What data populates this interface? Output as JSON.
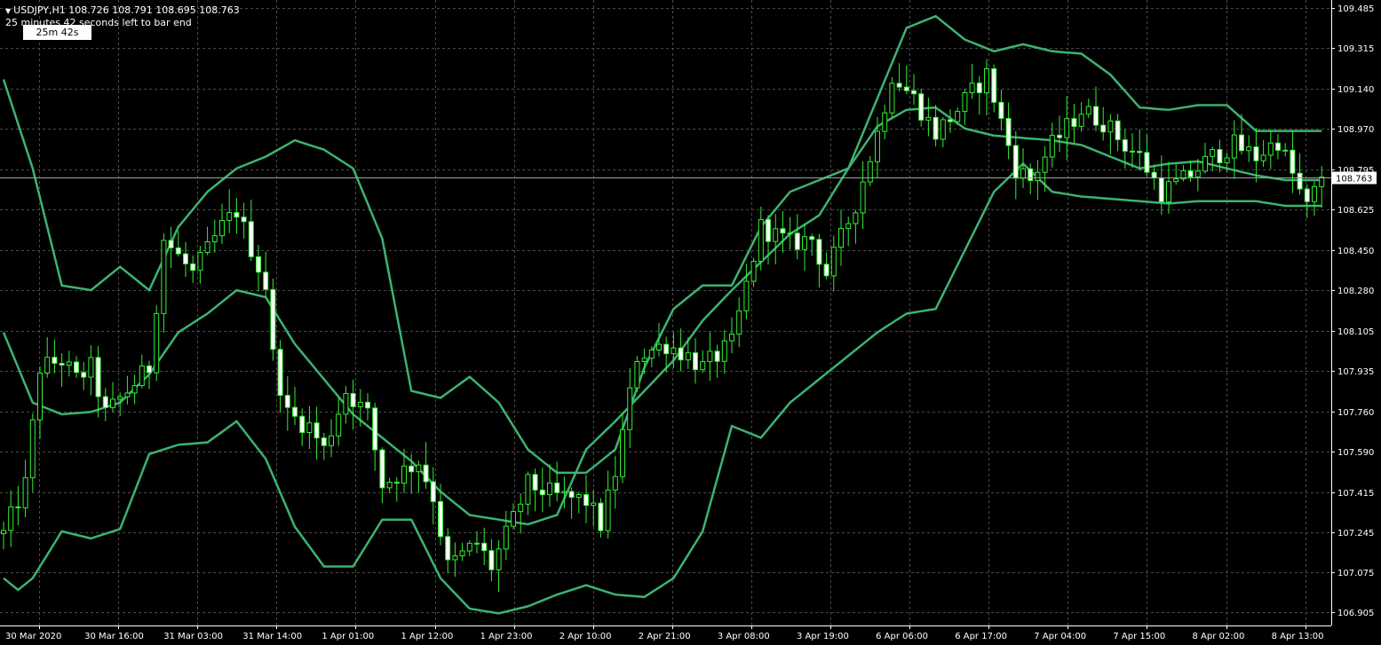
{
  "header": {
    "symbol_line": "USDJPY,H1  108.726 108.791 108.695 108.763",
    "countdown_line": "25 minutes 42 seconds left to bar end",
    "timer_label": "25m 42s"
  },
  "colors": {
    "background": "#000000",
    "grid": "#4a4a4a",
    "axis": "#ffffff",
    "candle": "#32f032",
    "bands": "#3cb371",
    "price_line": "#a0a0a0",
    "price_tag_bg": "#ffffff",
    "price_tag_text": "#000000"
  },
  "chart_data": {
    "type": "candlestick",
    "symbol": "USDJPY",
    "timeframe": "H1",
    "current_price": 108.763,
    "current_price_label": "108.763",
    "ylim": [
      106.85,
      109.53
    ],
    "y_ticks": [
      106.905,
      107.075,
      107.245,
      107.415,
      107.59,
      107.76,
      107.935,
      108.105,
      108.28,
      108.45,
      108.625,
      108.795,
      108.97,
      109.14,
      109.315,
      109.485
    ],
    "y_tick_labels": [
      "106.905",
      "107.075",
      "107.245",
      "107.415",
      "107.590",
      "107.760",
      "107.935",
      "108.105",
      "108.280",
      "108.450",
      "108.625",
      "108.795",
      "108.970",
      "109.140",
      "109.315",
      "109.485"
    ],
    "x_labels": [
      "30 Mar 2020",
      "30 Mar 16:00",
      "31 Mar 03:00",
      "31 Mar 14:00",
      "1 Apr 01:00",
      "1 Apr 12:00",
      "1 Apr 23:00",
      "2 Apr 10:00",
      "2 Apr 21:00",
      "3 Apr 08:00",
      "3 Apr 19:00",
      "6 Apr 06:00",
      "6 Apr 17:00",
      "7 Apr 04:00",
      "7 Apr 15:00",
      "8 Apr 02:00",
      "8 Apr 13:00"
    ],
    "bar_count": 182,
    "bars_per_label": 11,
    "anchors": [
      [
        0,
        107.24
      ],
      [
        3,
        107.45
      ],
      [
        5,
        107.95
      ],
      [
        8,
        107.98
      ],
      [
        10,
        107.9
      ],
      [
        12,
        107.95
      ],
      [
        14,
        107.75
      ],
      [
        17,
        107.85
      ],
      [
        20,
        107.95
      ],
      [
        22,
        108.5
      ],
      [
        26,
        108.35
      ],
      [
        30,
        108.55
      ],
      [
        32,
        108.62
      ],
      [
        36,
        108.3
      ],
      [
        37,
        108.0
      ],
      [
        39,
        107.75
      ],
      [
        42,
        107.7
      ],
      [
        44,
        107.6
      ],
      [
        47,
        107.85
      ],
      [
        50,
        107.75
      ],
      [
        52,
        107.45
      ],
      [
        57,
        107.55
      ],
      [
        59,
        107.4
      ],
      [
        61,
        107.1
      ],
      [
        65,
        107.2
      ],
      [
        67,
        107.1
      ],
      [
        70,
        107.3
      ],
      [
        72,
        107.45
      ],
      [
        76,
        107.4
      ],
      [
        80,
        107.38
      ],
      [
        82,
        107.28
      ],
      [
        84,
        107.5
      ],
      [
        87,
        108.0
      ],
      [
        91,
        108.05
      ],
      [
        94,
        108.0
      ],
      [
        96,
        107.95
      ],
      [
        100,
        108.05
      ],
      [
        104,
        108.55
      ],
      [
        108,
        108.48
      ],
      [
        111,
        108.5
      ],
      [
        113,
        108.35
      ],
      [
        117,
        108.65
      ],
      [
        120,
        108.95
      ],
      [
        122,
        109.2
      ],
      [
        125,
        109.1
      ],
      [
        128,
        108.95
      ],
      [
        131,
        109.05
      ],
      [
        135,
        109.2
      ],
      [
        139,
        108.8
      ],
      [
        141,
        108.75
      ],
      [
        144,
        108.9
      ],
      [
        148,
        109.05
      ],
      [
        151,
        109.0
      ],
      [
        154,
        108.9
      ],
      [
        156,
        108.85
      ],
      [
        159,
        108.7
      ],
      [
        162,
        108.75
      ],
      [
        166,
        108.85
      ],
      [
        169,
        108.9
      ],
      [
        172,
        108.85
      ],
      [
        175,
        108.92
      ],
      [
        178,
        108.7
      ],
      [
        179,
        108.63
      ],
      [
        181,
        108.763
      ]
    ],
    "upper_band": [
      [
        0,
        109.18
      ],
      [
        4,
        108.8
      ],
      [
        8,
        108.3
      ],
      [
        12,
        108.28
      ],
      [
        16,
        108.38
      ],
      [
        20,
        108.28
      ],
      [
        24,
        108.55
      ],
      [
        28,
        108.7
      ],
      [
        32,
        108.8
      ],
      [
        36,
        108.85
      ],
      [
        40,
        108.92
      ],
      [
        44,
        108.88
      ],
      [
        48,
        108.8
      ],
      [
        52,
        108.5
      ],
      [
        56,
        107.85
      ],
      [
        60,
        107.82
      ],
      [
        64,
        107.91
      ],
      [
        68,
        107.8
      ],
      [
        72,
        107.6
      ],
      [
        76,
        107.5
      ],
      [
        80,
        107.5
      ],
      [
        84,
        107.6
      ],
      [
        88,
        107.95
      ],
      [
        92,
        108.2
      ],
      [
        96,
        108.3
      ],
      [
        100,
        108.3
      ],
      [
        104,
        108.55
      ],
      [
        108,
        108.7
      ],
      [
        112,
        108.75
      ],
      [
        116,
        108.8
      ],
      [
        120,
        109.1
      ],
      [
        124,
        109.4
      ],
      [
        128,
        109.45
      ],
      [
        132,
        109.35
      ],
      [
        136,
        109.3
      ],
      [
        140,
        109.33
      ],
      [
        144,
        109.3
      ],
      [
        148,
        109.29
      ],
      [
        152,
        109.2
      ],
      [
        156,
        109.06
      ],
      [
        160,
        109.05
      ],
      [
        164,
        109.07
      ],
      [
        168,
        109.07
      ],
      [
        172,
        108.96
      ],
      [
        176,
        108.96
      ],
      [
        181,
        108.96
      ]
    ],
    "middle_band": [
      [
        0,
        108.1
      ],
      [
        4,
        107.8
      ],
      [
        8,
        107.75
      ],
      [
        12,
        107.76
      ],
      [
        16,
        107.8
      ],
      [
        20,
        107.92
      ],
      [
        24,
        108.1
      ],
      [
        28,
        108.18
      ],
      [
        32,
        108.28
      ],
      [
        36,
        108.25
      ],
      [
        40,
        108.05
      ],
      [
        44,
        107.9
      ],
      [
        48,
        107.75
      ],
      [
        52,
        107.65
      ],
      [
        56,
        107.55
      ],
      [
        60,
        107.42
      ],
      [
        64,
        107.32
      ],
      [
        68,
        107.3
      ],
      [
        72,
        107.28
      ],
      [
        76,
        107.32
      ],
      [
        80,
        107.6
      ],
      [
        84,
        107.72
      ],
      [
        88,
        107.85
      ],
      [
        92,
        107.98
      ],
      [
        96,
        108.15
      ],
      [
        100,
        108.28
      ],
      [
        104,
        108.4
      ],
      [
        108,
        108.52
      ],
      [
        112,
        108.6
      ],
      [
        116,
        108.8
      ],
      [
        120,
        108.98
      ],
      [
        124,
        109.05
      ],
      [
        128,
        109.06
      ],
      [
        132,
        108.97
      ],
      [
        136,
        108.94
      ],
      [
        140,
        108.93
      ],
      [
        144,
        108.92
      ],
      [
        148,
        108.9
      ],
      [
        152,
        108.85
      ],
      [
        156,
        108.8
      ],
      [
        160,
        108.82
      ],
      [
        164,
        108.83
      ],
      [
        168,
        108.8
      ],
      [
        172,
        108.77
      ],
      [
        176,
        108.75
      ],
      [
        181,
        108.75
      ]
    ],
    "lower_band": [
      [
        0,
        107.05
      ],
      [
        2,
        107.0
      ],
      [
        4,
        107.05
      ],
      [
        8,
        107.25
      ],
      [
        12,
        107.22
      ],
      [
        16,
        107.26
      ],
      [
        20,
        107.58
      ],
      [
        24,
        107.62
      ],
      [
        28,
        107.63
      ],
      [
        32,
        107.72
      ],
      [
        36,
        107.56
      ],
      [
        40,
        107.27
      ],
      [
        44,
        107.1
      ],
      [
        48,
        107.1
      ],
      [
        52,
        107.3
      ],
      [
        56,
        107.3
      ],
      [
        60,
        107.05
      ],
      [
        64,
        106.92
      ],
      [
        68,
        106.9
      ],
      [
        72,
        106.93
      ],
      [
        76,
        106.98
      ],
      [
        80,
        107.02
      ],
      [
        84,
        106.98
      ],
      [
        88,
        106.97
      ],
      [
        92,
        107.05
      ],
      [
        96,
        107.25
      ],
      [
        100,
        107.7
      ],
      [
        104,
        107.65
      ],
      [
        108,
        107.8
      ],
      [
        112,
        107.9
      ],
      [
        116,
        108.0
      ],
      [
        120,
        108.1
      ],
      [
        124,
        108.18
      ],
      [
        128,
        108.2
      ],
      [
        132,
        108.45
      ],
      [
        136,
        108.7
      ],
      [
        140,
        108.82
      ],
      [
        144,
        108.7
      ],
      [
        148,
        108.68
      ],
      [
        152,
        108.67
      ],
      [
        156,
        108.66
      ],
      [
        160,
        108.65
      ],
      [
        164,
        108.66
      ],
      [
        168,
        108.66
      ],
      [
        172,
        108.66
      ],
      [
        176,
        108.64
      ],
      [
        181,
        108.64
      ]
    ]
  }
}
